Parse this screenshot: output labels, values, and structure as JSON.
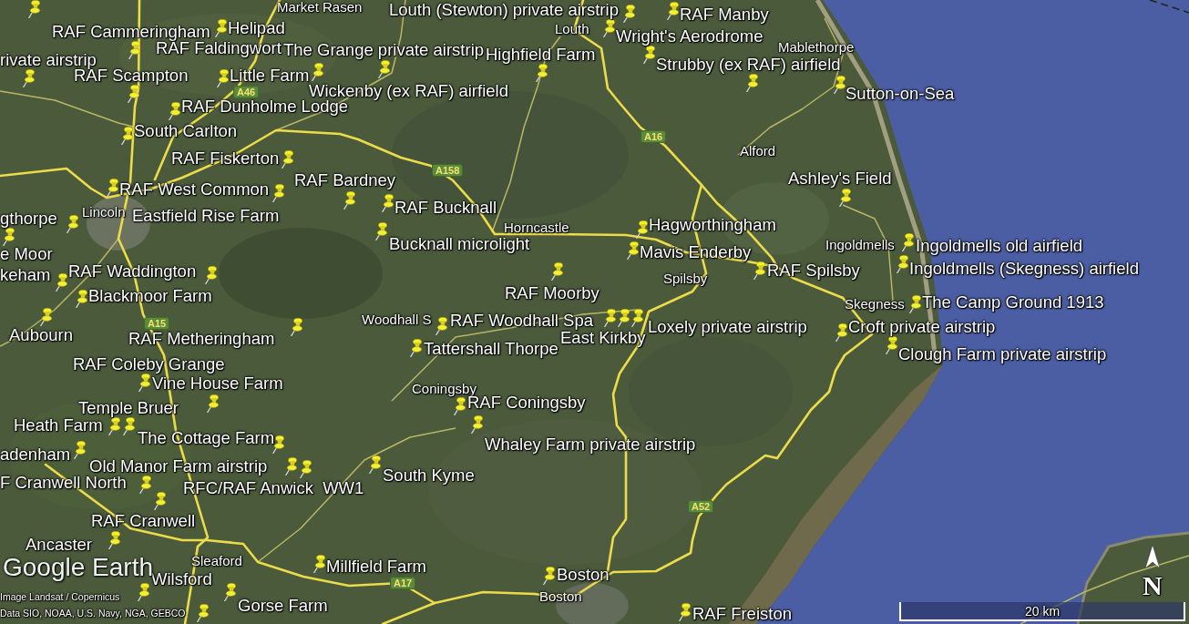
{
  "map": {
    "placemark_labels": [
      "Louth (Stewton) private airstrip",
      "RAF Manby",
      "RAF Cammeringham",
      "Helipad",
      "Wright's Aerodrome",
      "RAF Faldingwort",
      "The Grange private airstrip",
      "rivate airstrip",
      "Highfield Farm",
      "Strubby (ex RAF) airfield",
      "RAF Scampton",
      "Little Farm",
      "Wickenby (ex RAF) airfield",
      "Sutton-on-Sea",
      "RAF Dunholme Lodge",
      "South Carlton",
      "RAF Fiskerton",
      "RAF Bardney",
      "Ashley's Field",
      "RAF West Common",
      "RAF Bucknall",
      "gthorpe",
      "Eastfield Rise Farm",
      "Hagworthingham",
      "Bucknall microlight",
      "e Moor",
      "Mavis Enderby",
      "Ingoldmells old airfield",
      "keham",
      "RAF Waddington",
      "RAF Spilsby",
      "Ingoldmells (Skegness) airfield",
      "Blackmoor Farm",
      "RAF Moorby",
      "The Camp Ground 1913",
      "RAF Woodhall Spa",
      "Aubourn",
      "Loxely private airstrip",
      "Croft private airstrip",
      "RAF Metheringham",
      "East Kirkby",
      "Tattershall Thorpe",
      "Clough Farm private airstrip",
      "RAF Coleby Grange",
      "Vine House Farm",
      "Temple Bruer",
      "RAF Coningsby",
      "Heath Farm",
      "The Cottage Farm",
      "Whaley Farm private airstrip",
      "adenham",
      "Old Manor Farm airstrip",
      "F Cranwell North",
      "South Kyme",
      "RFC/RAF Anwick  WW1",
      "RAF Cranwell",
      "Ancaster",
      "Millfield Farm",
      "Wilsford",
      "Boston",
      "Gorse Farm",
      "RAF Freiston"
    ],
    "place_names": [
      "Market Rasen",
      "Louth",
      "Mablethorpe",
      "Alford",
      "Lincoln",
      "Horncastle",
      "Ingoldmells",
      "Spilsby",
      "Skegness",
      "Woodhall S",
      "Coningsby",
      "Sleaford",
      "Boston"
    ],
    "road_signs": [
      "A46",
      "A16",
      "A158",
      "A15",
      "A52",
      "A17"
    ]
  },
  "logo": "Google Earth",
  "attribution": [
    "Image Landsat / Copernicus",
    "Data SIO, NOAA, U.S. Navy, NGA, GEBCO"
  ],
  "scale_bar": {
    "label": "20 km"
  },
  "compass": {
    "label": "N"
  }
}
